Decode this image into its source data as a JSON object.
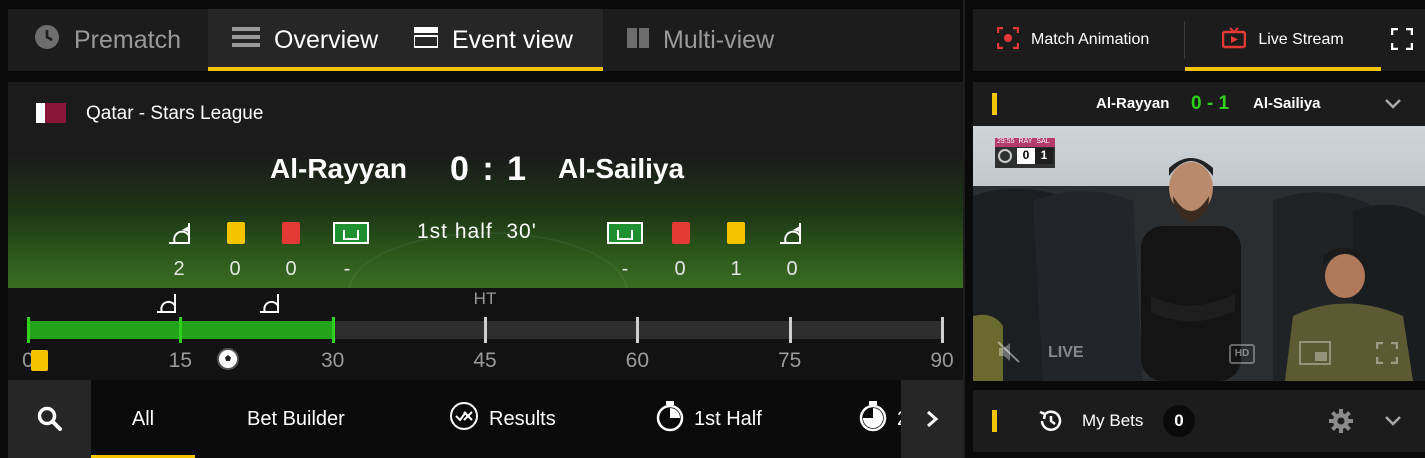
{
  "view_tabs": [
    {
      "label": "Prematch",
      "icon": "clock-icon",
      "active": false
    },
    {
      "label": "Overview",
      "icon": "list-icon",
      "active": true
    },
    {
      "label": "Event view",
      "icon": "event-view-icon",
      "active": true
    },
    {
      "label": "Multi-view",
      "icon": "multi-view-icon",
      "active": false
    }
  ],
  "scoreboard": {
    "league": "Qatar - Stars League",
    "home_team": "Al-Rayyan",
    "away_team": "Al-Sailiya",
    "score": "0 : 1",
    "period": "1st half  30'",
    "home_stats": {
      "corners": "2",
      "yellow": "0",
      "red": "0",
      "penalties": "-"
    },
    "away_stats": {
      "penalties": "-",
      "red": "0",
      "yellow": "1",
      "corners": "0"
    }
  },
  "timeline": {
    "ht_label": "HT",
    "ticks": [
      "0",
      "15",
      "30",
      "45",
      "60",
      "75",
      "90"
    ],
    "progress_minutes": 30
  },
  "market_tabs": [
    {
      "label": "All",
      "active": true
    },
    {
      "label": "Bet Builder",
      "active": false
    },
    {
      "label": "Results",
      "icon": "results-icon"
    },
    {
      "label": "1st Half",
      "icon": "stopwatch-icon"
    },
    {
      "label": "2",
      "icon": "stopwatch-icon"
    }
  ],
  "right_panel": {
    "tabs": [
      {
        "label": "Match Animation",
        "icon": "match-animation-icon",
        "active": false
      },
      {
        "label": "Live Stream",
        "icon": "tv-icon",
        "active": true
      }
    ],
    "match_header": {
      "home": "Al-Rayyan",
      "score": "0 - 1",
      "away": "Al-Sailiya"
    },
    "video": {
      "scorebug_time": "29:55",
      "scorebug_home": "RAY",
      "scorebug_away": "SAL",
      "scorebug_home_score": "0",
      "scorebug_away_score": "1",
      "live_label": "LIVE",
      "quality_label": "HD"
    },
    "my_bets": {
      "label": "My Bets",
      "count": "0"
    }
  },
  "colors": {
    "accent": "#f5c400",
    "green": "#24a31a",
    "score_green": "#2fd11d",
    "red_card": "#e53935"
  }
}
